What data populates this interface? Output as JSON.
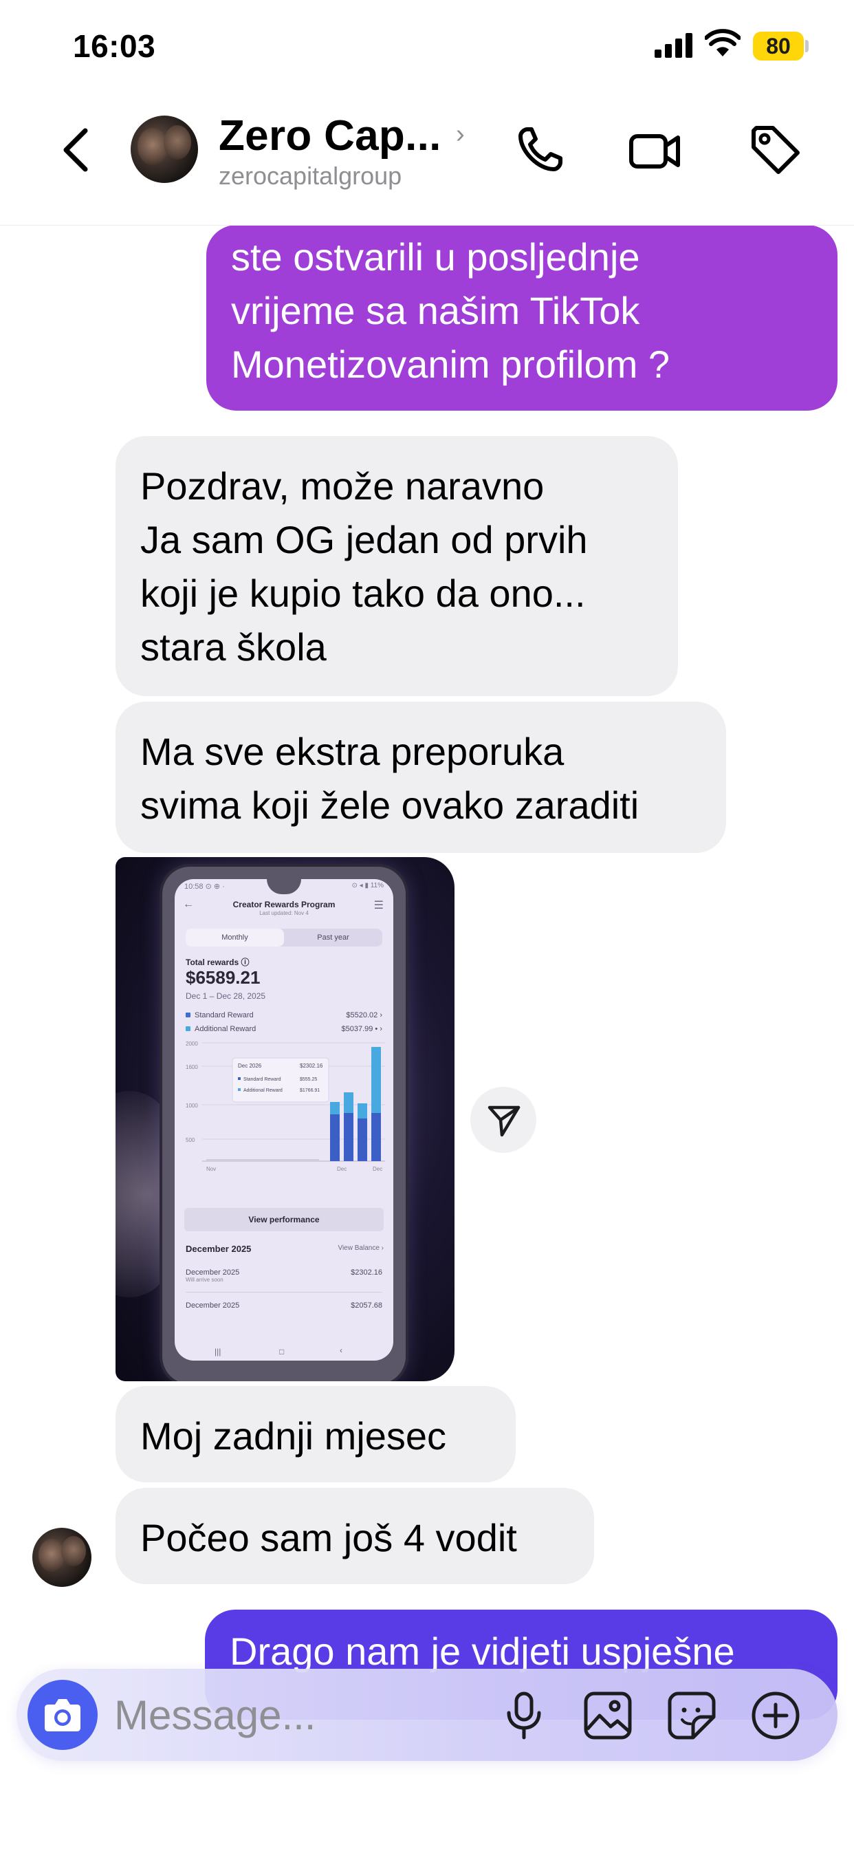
{
  "status_bar": {
    "time": "16:03",
    "battery": "80",
    "icons": [
      "signal-bars-icon",
      "wifi-icon",
      "battery-icon"
    ]
  },
  "header": {
    "name": "Zero Cap...",
    "username": "zerocapitalgroup",
    "chevron": "›",
    "icons": [
      "back-chevron-icon",
      "phone-icon",
      "video-camera-icon",
      "tag-icon"
    ]
  },
  "messages": [
    {
      "direction": "outgoing",
      "text": "ste ostvarili u posljednje\nvrijeme sa našim TikTok\nMonetizovanim profilom ?",
      "color": "#9f3fd8"
    },
    {
      "direction": "incoming",
      "text": "Pozdrav, može naravno\nJa sam OG jedan od prvih\nkoji je kupio tako da ono...\nstara škola"
    },
    {
      "direction": "incoming",
      "text": "Ma sve ekstra preporuka\nsvima koji žele ovako zaraditi"
    },
    {
      "direction": "incoming",
      "type": "photo",
      "photo": {
        "status_left": "10:58 ⊙ ⊕ ·",
        "status_right": "⊙ ◂ ▮ 11%",
        "title": "Creator Rewards Program",
        "subtitle": "Last updated: Nov 4",
        "toggle": [
          "Monthly",
          "Past year"
        ],
        "total_label": "Total rewards ⓘ",
        "total_value": "$6589.21",
        "date_range": "Dec 1 – Dec 28, 2025",
        "rows": [
          {
            "label": "Standard Reward",
            "value": "$5520.02 ›",
            "color": "#3b6fd6"
          },
          {
            "label": "Additional Reward",
            "value": "$5037.99 • ›",
            "color": "#46a8e0"
          }
        ],
        "tooltip": {
          "date": "Dec 2026",
          "total": "$2302.16",
          "standard_label": "Standard Reward",
          "standard_value": "$555.25",
          "additional_label": "Additional Reward",
          "additional_value": "$1766.91"
        },
        "chart": {
          "y_ticks": [
            "2000",
            "1600",
            "1000",
            "500"
          ],
          "x_ticks": [
            "Nov",
            "Dec",
            "Dec"
          ]
        },
        "button": "View performance",
        "section_title": "December 2025",
        "section_link": "View Balance ›",
        "items": [
          {
            "label": "December 2025",
            "note": "Will arrive soon",
            "value": "$2302.16"
          },
          {
            "label": "December 2025",
            "note": "",
            "value": "$2057.68"
          }
        ],
        "navbar": [
          "|||",
          "□",
          "‹"
        ]
      }
    },
    {
      "direction": "incoming",
      "text": "Moj zadnji mjesec"
    },
    {
      "direction": "incoming",
      "text": "Počeo sam još 4 vodit"
    },
    {
      "direction": "outgoing",
      "text": "Drago nam je vidjeti uspješne",
      "color": "#5a3ce6"
    }
  ],
  "share_icon": "paper-plane-icon",
  "composer": {
    "placeholder": "Message...",
    "icons": [
      "camera-icon",
      "microphone-icon",
      "image-icon",
      "sticker-icon",
      "plus-circle-icon"
    ],
    "accent": "#4a5ff0"
  }
}
